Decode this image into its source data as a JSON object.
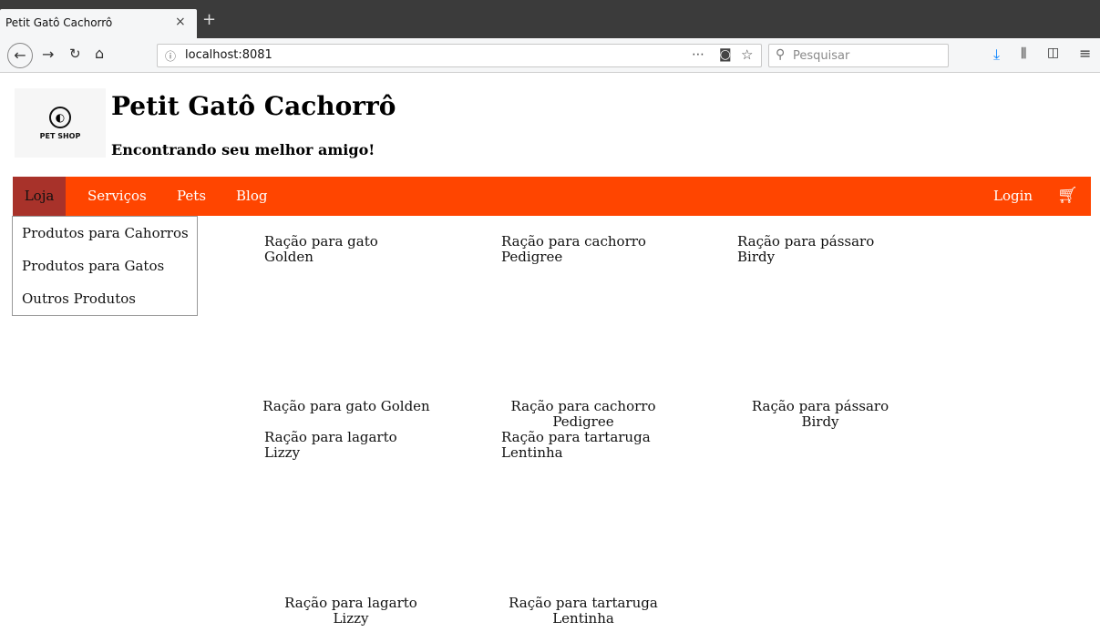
{
  "browser": {
    "tab_title": "Petit Gatô Cachorrô",
    "tab_close": "×",
    "new_tab": "+",
    "url": "localhost:8081",
    "search_placeholder": "Pesquisar"
  },
  "header": {
    "logo_text": "PET SHOP",
    "title": "Petit Gatô Cachorrô",
    "subtitle": "Encontrando seu melhor amigo!"
  },
  "nav": {
    "items": [
      "Loja",
      "Serviços",
      "Pets",
      "Blog"
    ],
    "login": "Login",
    "accent": "#ff4500",
    "active_bg": "#a8322a"
  },
  "dropdown": {
    "items": [
      "Produtos para Cahorros",
      "Produtos para Gatos",
      "Outros Produtos"
    ]
  },
  "products": {
    "row1": [
      {
        "line1": "Ração para gato",
        "line2": "Golden"
      },
      {
        "line1": "Ração para cachorro",
        "line2": "Pedigree"
      },
      {
        "line1": "Ração para pássaro",
        "line2": "Birdy"
      }
    ],
    "row1_captions": [
      {
        "line1": "Ração para gato Golden",
        "line2": ""
      },
      {
        "line1": "Ração para cachorro",
        "line2": "Pedigree"
      },
      {
        "line1": "Ração para pássaro",
        "line2": "Birdy"
      }
    ],
    "row2": [
      {
        "line1": "Ração para lagarto",
        "line2": "Lizzy"
      },
      {
        "line1": "Ração para tartaruga",
        "line2": "Lentinha"
      }
    ],
    "row2_captions": [
      {
        "line1": "Ração para lagarto",
        "line2": "Lizzy"
      },
      {
        "line1": "Ração para tartaruga",
        "line2": "Lentinha"
      }
    ]
  }
}
